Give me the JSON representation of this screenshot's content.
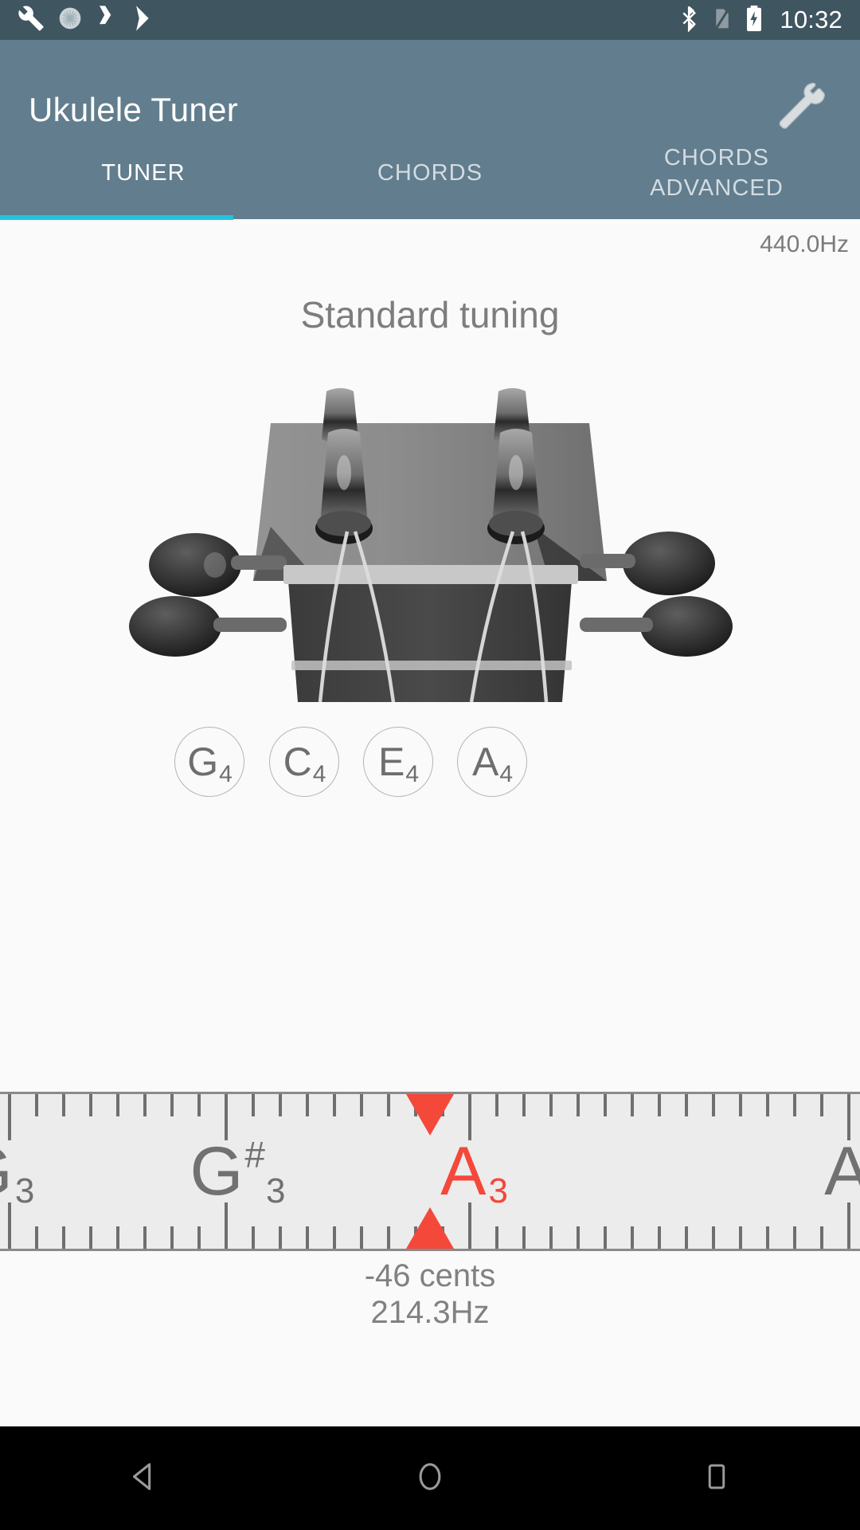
{
  "status_bar": {
    "time": "10:32",
    "left_icons": [
      "wrench-icon",
      "sun-brightness-icon",
      "vlc-icon",
      "play-store-icon"
    ],
    "right_icons": [
      "bluetooth-icon",
      "no-sim-icon",
      "battery-charging-icon"
    ]
  },
  "app_bar": {
    "title": "Ukulele Tuner",
    "action_icon": "wrench-settings-icon",
    "background_color": "#627d8d"
  },
  "tabs": {
    "items": [
      {
        "label": "TUNER",
        "active": true
      },
      {
        "label": "CHORDS",
        "active": false
      },
      {
        "label": "CHORDS\nADVANCED",
        "active": false
      }
    ],
    "indicator_color": "#21c4e0"
  },
  "tuner": {
    "reference_frequency": "440.0Hz",
    "tuning_name": "Standard tuning",
    "strings": [
      {
        "note": "G",
        "octave": "4"
      },
      {
        "note": "C",
        "octave": "4"
      },
      {
        "note": "E",
        "octave": "4"
      },
      {
        "note": "A",
        "octave": "4"
      }
    ],
    "readout": {
      "cents": "-46 cents",
      "frequency": "214.3Hz"
    },
    "gauge": {
      "detected_color": "#f4483a",
      "notes": [
        {
          "letter": "G",
          "sharp": "",
          "octave": "3",
          "x_percent": -0.5,
          "current": false
        },
        {
          "letter": "G",
          "sharp": "#",
          "octave": "3",
          "x_percent": 27.5,
          "current": false
        },
        {
          "letter": "A",
          "sharp": "",
          "octave": "3",
          "x_percent": 55.0,
          "current": true
        },
        {
          "letter": "A",
          "sharp": "",
          "octave": "",
          "x_percent": 98.5,
          "current": false
        }
      ]
    }
  },
  "nav_bar": {
    "buttons": [
      "back-triangle-icon",
      "home-circle-icon",
      "recents-square-icon"
    ]
  }
}
